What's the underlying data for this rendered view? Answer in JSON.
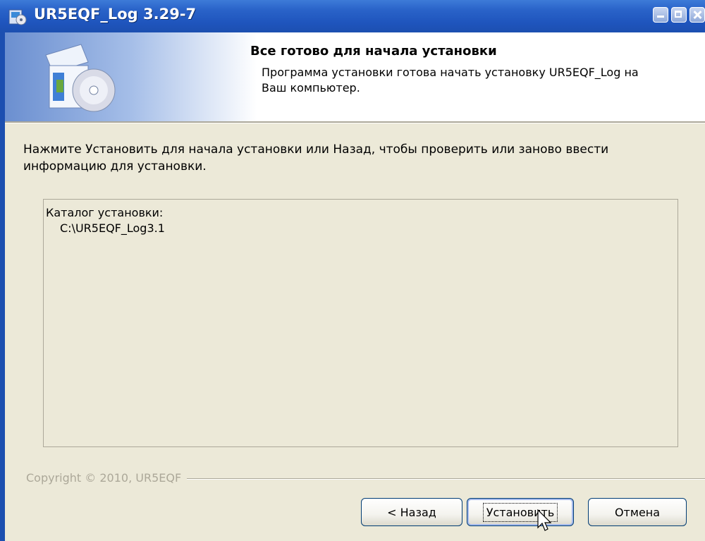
{
  "window": {
    "title": "UR5EQF_Log 3.29-7",
    "colors": {
      "titlebar": "#1f55bd",
      "face": "#ece9d8"
    }
  },
  "header": {
    "title": "Все готово для начала установки",
    "subtitle": "Программа установки готова начать установку UR5EQF_Log на Ваш компьютер."
  },
  "body": {
    "instruction": "Нажмите Установить для начала установки или Назад, чтобы проверить или заново ввести информацию для установки.",
    "memo": {
      "label": "Каталог установки:",
      "path": "C:\\UR5EQF_Log3.1"
    }
  },
  "footer": {
    "copyright": "Copyright © 2010, UR5EQF"
  },
  "buttons": {
    "back": "< Назад",
    "install": "Установить",
    "cancel": "Отмена"
  },
  "icons": {
    "title": "installer-icon",
    "header": "installer-box-disc-icon",
    "cursor": "mouse-pointer-icon"
  }
}
